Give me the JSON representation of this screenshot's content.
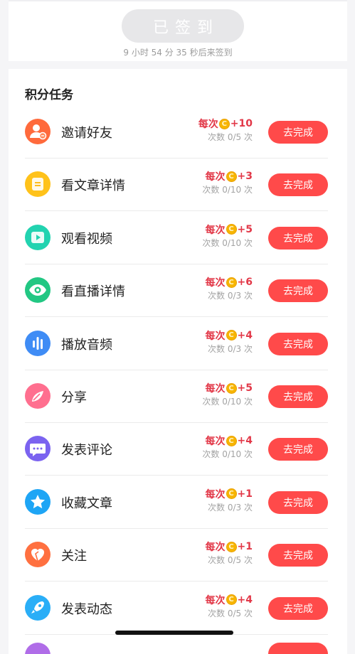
{
  "checkin": {
    "button_label": "已签到",
    "countdown": "9 小时 54 分 35 秒后来签到"
  },
  "tasks_section": {
    "title": "积分任务",
    "tasks": [
      {
        "name": "邀请好友",
        "reward_label": "每次",
        "reward_points": "+10",
        "count": "次数 0/5 次",
        "button_label": "去完成",
        "icon": "invite-user-icon",
        "color": "#ff6a3c"
      },
      {
        "name": "看文章详情",
        "reward_label": "每次",
        "reward_points": "+3",
        "count": "次数 0/10 次",
        "button_label": "去完成",
        "icon": "article-icon",
        "color": "#ffc21a"
      },
      {
        "name": "观看视频",
        "reward_label": "每次",
        "reward_points": "+5",
        "count": "次数 0/10 次",
        "button_label": "去完成",
        "icon": "video-icon",
        "color": "#22d3b0"
      },
      {
        "name": "看直播详情",
        "reward_label": "每次",
        "reward_points": "+6",
        "count": "次数 0/3 次",
        "button_label": "去完成",
        "icon": "eye-icon",
        "color": "#22c783"
      },
      {
        "name": "播放音频",
        "reward_label": "每次",
        "reward_points": "+4",
        "count": "次数 0/3 次",
        "button_label": "去完成",
        "icon": "audio-icon",
        "color": "#3f8cf5"
      },
      {
        "name": "分享",
        "reward_label": "每次",
        "reward_points": "+5",
        "count": "次数 0/10 次",
        "button_label": "去完成",
        "icon": "share-icon",
        "color": "#ff6f8f"
      },
      {
        "name": "发表评论",
        "reward_label": "每次",
        "reward_points": "+4",
        "count": "次数 0/10 次",
        "button_label": "去完成",
        "icon": "comment-icon",
        "color": "#7b63f0"
      },
      {
        "name": "收藏文章",
        "reward_label": "每次",
        "reward_points": "+1",
        "count": "次数 0/3 次",
        "button_label": "去完成",
        "icon": "star-icon",
        "color": "#1ea5f5"
      },
      {
        "name": "关注",
        "reward_label": "每次",
        "reward_points": "+1",
        "count": "次数 0/5 次",
        "button_label": "去完成",
        "icon": "heart-icon",
        "color": "#ff7040"
      },
      {
        "name": "发表动态",
        "reward_label": "每次",
        "reward_points": "+4",
        "count": "次数 0/5 次",
        "button_label": "去完成",
        "icon": "rocket-icon",
        "color": "#2aaef7"
      }
    ]
  }
}
